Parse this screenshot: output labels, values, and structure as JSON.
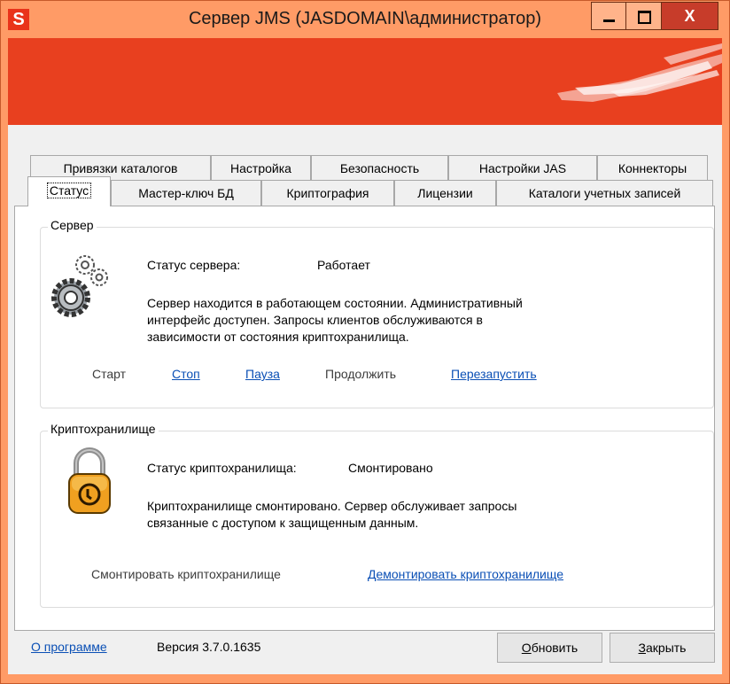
{
  "window": {
    "app_icon_letter": "S",
    "title": "Сервер JMS (JASDOMAIN\\администратор)",
    "close_glyph": "X",
    "colors": {
      "frame": "#ff9b66",
      "banner": "#e8401f",
      "link": "#0a4fb5"
    }
  },
  "tabs_row1": [
    "Привязки каталогов",
    "Настройка",
    "Безопасность",
    "Настройки JAS",
    "Коннекторы"
  ],
  "tabs_row2": [
    "Статус",
    "Мастер-ключ БД",
    "Криптография",
    "Лицензии",
    "Каталоги учетных записей"
  ],
  "active_tab": "Статус",
  "server": {
    "legend": "Сервер",
    "icon": "gears-icon",
    "status_label": "Статус сервера:",
    "status_value": "Работает",
    "description_line1": "Сервер находится в работающем состоянии. Административный",
    "description_line2": "интерфейс доступен. Запросы клиентов обслуживаются в",
    "description_line3": "зависимости от состояния криптохранилища.",
    "actions": {
      "start": "Старт",
      "stop": "Стоп",
      "pause": "Пауза",
      "resume": "Продолжить",
      "restart": "Перезапустить"
    }
  },
  "vault": {
    "legend": "Криптохранилище",
    "icon": "padlock-icon",
    "status_label": "Статус криптохранилища:",
    "status_value": "Смонтировано",
    "description_line1": "Криптохранилище смонтировано. Сервер обслуживает запросы",
    "description_line2": "связанные с доступом к защищенным данным.",
    "actions": {
      "mount": "Смонтировать криптохранилище",
      "unmount": "Демонтировать криптохранилище"
    }
  },
  "footer": {
    "about_link": "О программе",
    "version_text": "Версия 3.7.0.1635",
    "refresh_first": "О",
    "refresh_rest": "бновить",
    "close_first": "З",
    "close_rest": "акрыть"
  }
}
